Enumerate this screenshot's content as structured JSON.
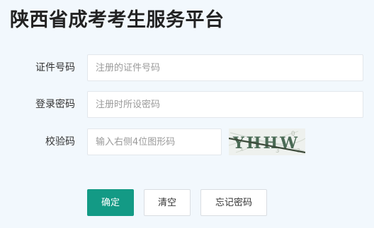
{
  "page": {
    "title": "陕西省成考考生服务平台"
  },
  "form": {
    "id_label": "证件号码",
    "id_placeholder": "注册的证件号码",
    "password_label": "登录密码",
    "password_placeholder": "注册时所设密码",
    "captcha_label": "校验码",
    "captcha_placeholder": "输入右侧4位图形码",
    "captcha_text": "YHHW"
  },
  "buttons": {
    "confirm": "确定",
    "clear": "清空",
    "forgot": "忘记密码"
  },
  "colors": {
    "primary": "#139a85",
    "background": "#f2f8fd"
  }
}
